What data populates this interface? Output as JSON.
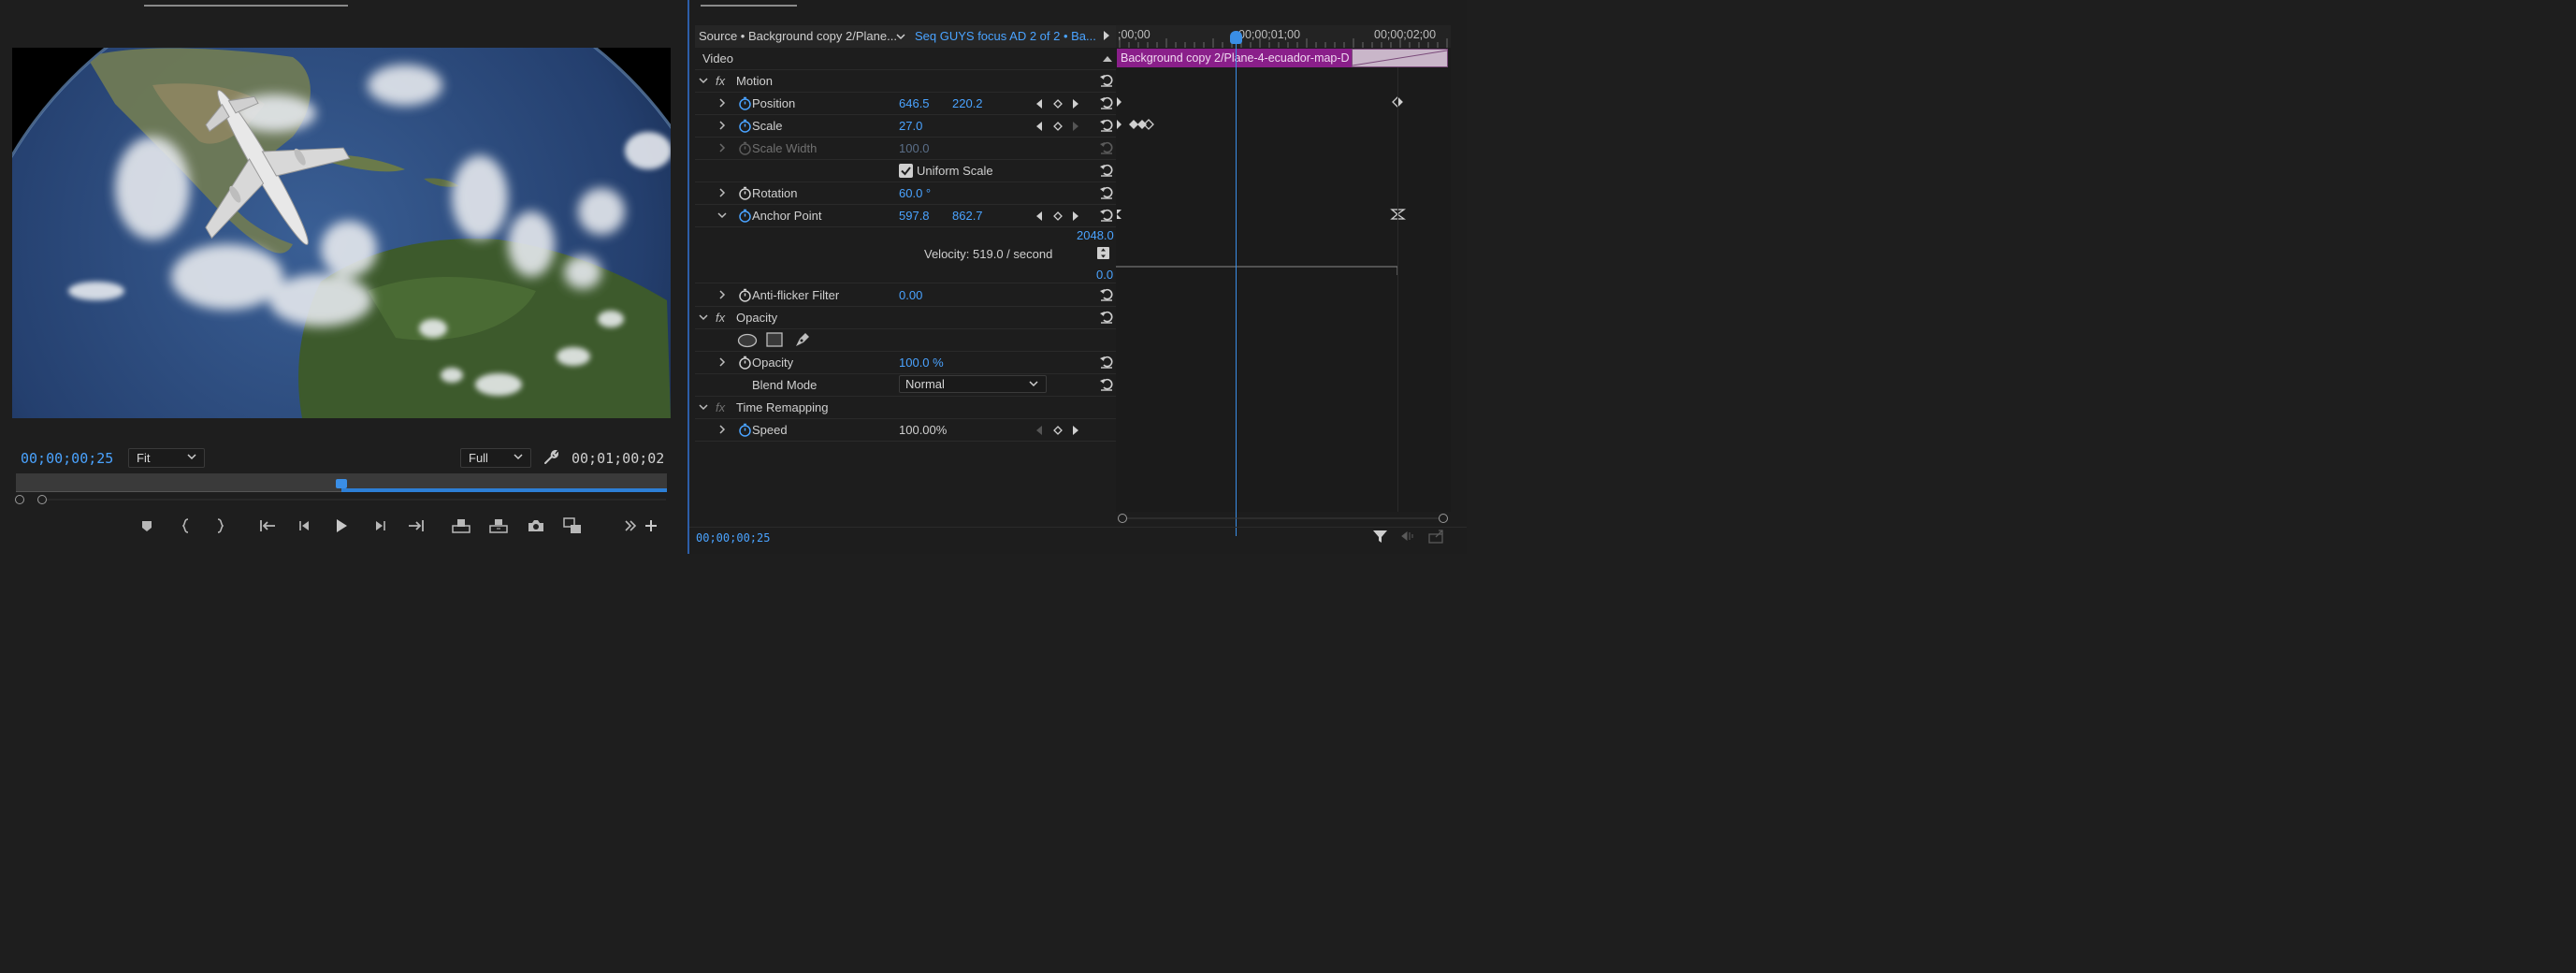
{
  "program_monitor": {
    "current_timecode": "00;00;00;25",
    "zoom": "Fit",
    "resolution": "Full",
    "duration_timecode": "00;01;00;02",
    "playhead_fraction": 0.5
  },
  "effect_controls": {
    "source_label": "Source • Background copy 2/Plane...",
    "sequence_label": "Seq GUYS focus AD 2 of 2 • Ba...",
    "section_video": "Video",
    "motion": {
      "label": "Motion",
      "position_label": "Position",
      "position_x": "646.5",
      "position_y": "220.2",
      "scale_label": "Scale",
      "scale_value": "27.0",
      "scale_width_label": "Scale Width",
      "scale_width_value": "100.0",
      "uniform_scale_label": "Uniform Scale",
      "rotation_label": "Rotation",
      "rotation_value": "60.0 °",
      "anchor_label": "Anchor Point",
      "anchor_x": "597.8",
      "anchor_y": "862.7",
      "graph_max": "2048.0",
      "velocity": "Velocity: 519.0 / second",
      "graph_min": "0.0",
      "antiflicker_label": "Anti-flicker Filter",
      "antiflicker_value": "0.00"
    },
    "opacity": {
      "label": "Opacity",
      "opacity_label": "Opacity",
      "opacity_value": "100.0 %",
      "blend_label": "Blend Mode",
      "blend_value": "Normal"
    },
    "time_remap": {
      "label": "Time Remapping",
      "speed_label": "Speed",
      "speed_value": "100.00%"
    },
    "timeline": {
      "ruler_start": ";00;00",
      "ruler_mid": "00;00;01;00",
      "ruler_end": "00;00;02;00",
      "clip_name": "Background copy 2/Plane-4-ecuador-map-D"
    },
    "bottom_timecode": "00;00;00;25"
  },
  "fx_symbol": "fx",
  "colors": {
    "accent": "#4aa3ff",
    "clip": "#8a1f8a",
    "playhead": "#3a8ee6"
  }
}
